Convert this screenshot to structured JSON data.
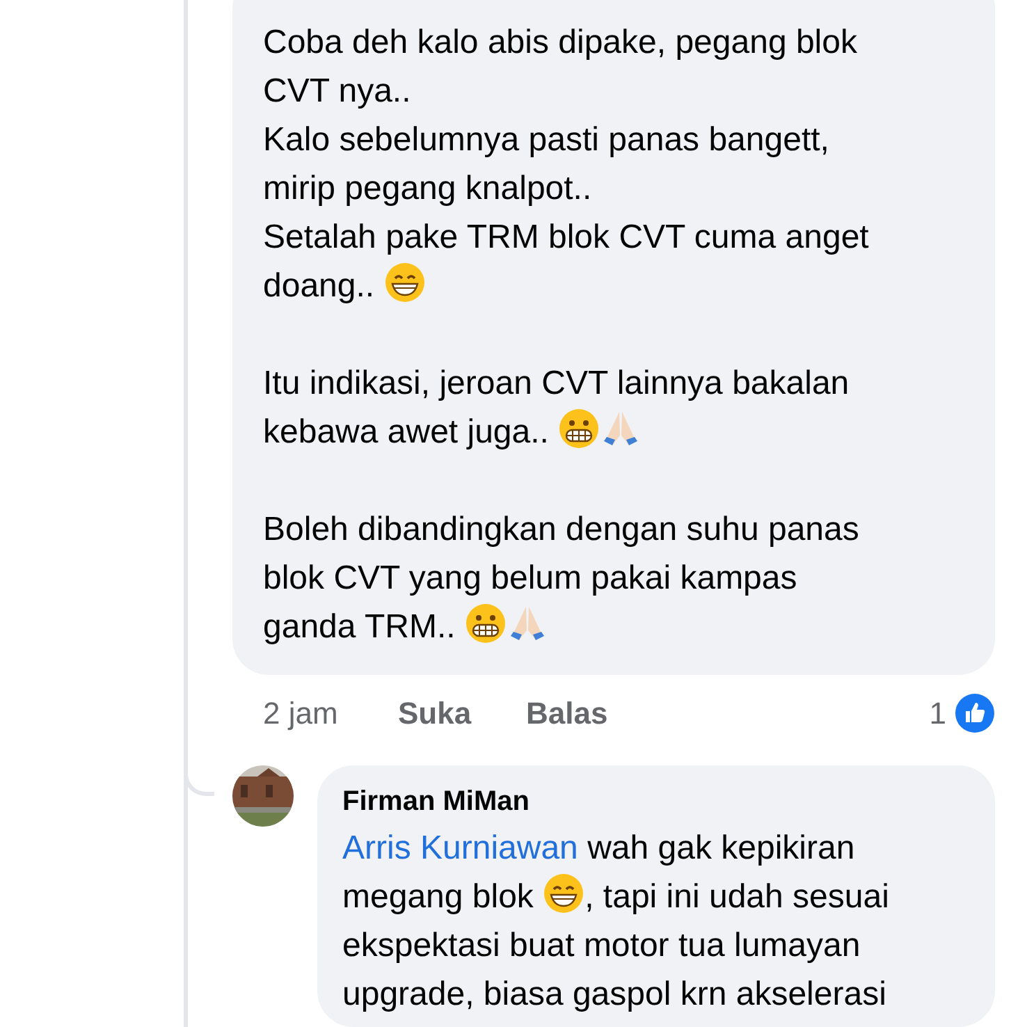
{
  "comments": [
    {
      "paragraphs": [
        [
          [
            {
              "kind": "text",
              "text": "Coba deh kalo abis dipake, pegang blok"
            }
          ],
          [
            {
              "kind": "text",
              "text": "CVT nya.."
            }
          ],
          [
            {
              "kind": "text",
              "text": "Kalo sebelumnya pasti panas bangett,"
            }
          ],
          [
            {
              "kind": "text",
              "text": "mirip pegang knalpot.."
            }
          ],
          [
            {
              "kind": "text",
              "text": "Setalah pake TRM blok CVT cuma anget"
            }
          ],
          [
            {
              "kind": "text",
              "text": "doang.. "
            },
            {
              "kind": "grin"
            }
          ]
        ],
        [
          [
            {
              "kind": "text",
              "text": "Itu indikasi, jeroan CVT lainnya bakalan"
            }
          ],
          [
            {
              "kind": "text",
              "text": "kebawa awet juga.. "
            },
            {
              "kind": "grimace"
            },
            {
              "kind": "pray"
            }
          ]
        ],
        [
          [
            {
              "kind": "text",
              "text": "Boleh dibandingkan dengan suhu panas"
            }
          ],
          [
            {
              "kind": "text",
              "text": "blok CVT yang belum pakai kampas"
            }
          ],
          [
            {
              "kind": "text",
              "text": "ganda TRM.. "
            },
            {
              "kind": "grimace"
            },
            {
              "kind": "pray"
            }
          ]
        ]
      ],
      "actions": {
        "time": "2 jam",
        "like": "Suka",
        "reply": "Balas",
        "like_count": "1"
      }
    },
    {
      "author": "Firman MiMan",
      "avatar": {
        "kind": "picture"
      },
      "paragraphs": [
        [
          [
            {
              "kind": "link",
              "text": "Arris Kurniawan"
            },
            {
              "kind": "text",
              "text": " wah gak kepikiran"
            }
          ],
          [
            {
              "kind": "text",
              "text": "megang blok "
            },
            {
              "kind": "grin"
            },
            {
              "kind": "text",
              "text": ", tapi ini udah sesuai"
            }
          ],
          [
            {
              "kind": "text",
              "text": "ekspektasi buat motor tua lumayan"
            }
          ],
          [
            {
              "kind": "text",
              "text": "upgrade, biasa gaspol krn akselerasi"
            }
          ]
        ]
      ]
    }
  ]
}
